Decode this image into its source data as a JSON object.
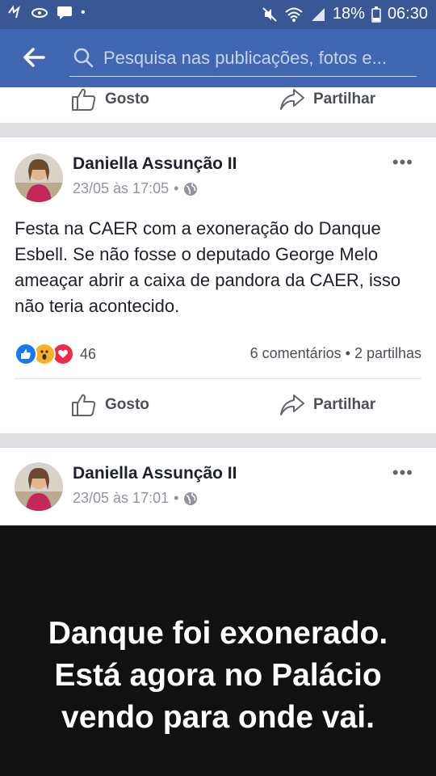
{
  "status_bar": {
    "battery": "18%",
    "time": "06:30"
  },
  "search": {
    "placeholder": "Pesquisa nas publicações, fotos e..."
  },
  "top_actions": {
    "like_label": "Gosto",
    "share_label": "Partilhar"
  },
  "post1": {
    "author": "Daniella Assunção II",
    "timestamp": "23/05 às 17:05",
    "privacy_sep": "•",
    "text": "Festa na CAER com a exoneração do Danque Esbell. Se não fosse o deputado George Melo ameaçar abrir a caixa de pandora da CAER, isso não teria acontecido.",
    "reaction_count": "46",
    "comments_shares": "6 comentários • 2 partilhas",
    "like_label": "Gosto",
    "share_label": "Partilhar"
  },
  "post2": {
    "author": "Daniella Assunção II",
    "timestamp": "23/05 às 17:01",
    "privacy_sep": "•",
    "image_text_lines": [
      "Danque foi exonerado.",
      "Está agora no Palácio",
      "vendo para onde vai."
    ]
  },
  "colors": {
    "status_bar": "#3a5795",
    "header": "#4267b2",
    "like_blue": "#1877f2",
    "love_red": "#f0284a",
    "wow_yellow": "#f7b125"
  },
  "icons": [
    "wifi-icon",
    "signal-icon",
    "battery-icon",
    "search-icon",
    "back-arrow-icon",
    "like-icon",
    "share-icon",
    "globe-icon",
    "more-icon"
  ]
}
